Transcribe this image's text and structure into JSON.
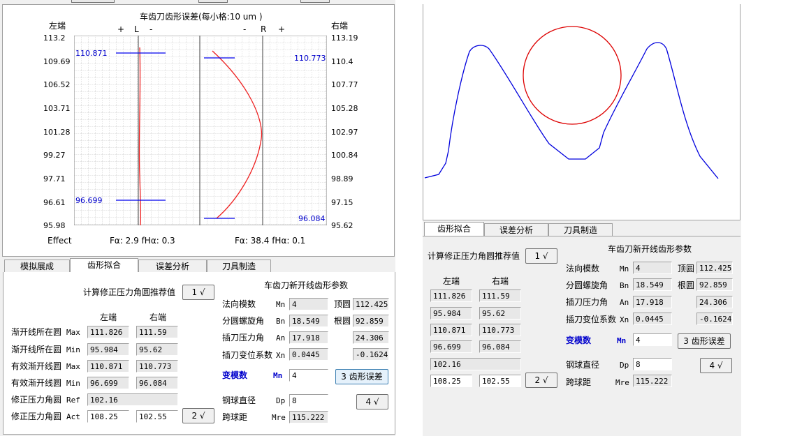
{
  "chart": {
    "title": "车齿刀齿形误差(每小格:10 um )",
    "left_label": "左端",
    "right_label": "右端",
    "L_marks": [
      "+",
      "L",
      "-"
    ],
    "R_marks": [
      "-",
      "R",
      "+"
    ],
    "left_ticks": [
      "113.2",
      "109.69",
      "106.52",
      "103.71",
      "101.28",
      "99.27",
      "97.71",
      "96.61",
      "95.98"
    ],
    "right_ticks": [
      "113.19",
      "110.4",
      "107.77",
      "105.28",
      "102.97",
      "100.84",
      "98.89",
      "97.15",
      "95.62"
    ],
    "L_top": "110.871",
    "L_bottom": "96.699",
    "R_top": "110.773",
    "R_bottom": "96.084",
    "effect_label": "Effect",
    "L_effect": "Fα: 2.9   fHα: 0.3",
    "R_effect": "Fα: 38.4   fHα: 0.1"
  },
  "tabs_left": [
    "模拟展成",
    "齿形拟合",
    "误差分析",
    "刀具制造"
  ],
  "tabs_right": [
    "齿形拟合",
    "误差分析",
    "刀具制造"
  ],
  "left_panel": {
    "recommend_label": "计算修正压力角圆推荐值",
    "btn1": "1 √",
    "col_left": "左端",
    "col_right": "右端",
    "rows": [
      {
        "label": "渐开线所在圆",
        "code": "Max",
        "l": "111.826",
        "r": "111.59"
      },
      {
        "label": "渐开线所在圆",
        "code": "Min",
        "l": "95.984",
        "r": "95.62"
      },
      {
        "label": "有效渐开线圆",
        "code": "Max",
        "l": "110.871",
        "r": "110.773"
      },
      {
        "label": "有效渐开线圆",
        "code": "Min",
        "l": "96.699",
        "r": "96.084"
      }
    ],
    "ref_label": "修正压力角圆",
    "ref_code": "Ref",
    "ref_value": "102.16",
    "act_label": "修正压力角圆",
    "act_code": "Act",
    "act_l": "108.25",
    "act_r": "102.55",
    "btn2": "2 √"
  },
  "params": {
    "title": "车齿刀新开线齿形参数",
    "mn_label": "法向模数",
    "mn_code": "Mn",
    "mn_value": "4",
    "top_label": "顶圆",
    "top_value": "112.425",
    "bn_label": "分圆螺旋角",
    "bn_code": "Bn",
    "bn_value": "18.549",
    "root_label": "根圆",
    "root_value": "92.859",
    "an_label": "插刀压力角",
    "an_code": "An",
    "an_value": "17.918",
    "extra1": "24.306",
    "xn_label": "插刀变位系数",
    "xn_code": "Xn",
    "xn_value": "0.0445",
    "extra2": "-0.1624",
    "var_label": "变模数",
    "var_code": "Mn",
    "var_value": "4",
    "btn3": "3 齿形误差",
    "btn4": "4 √",
    "dp_label": "钢球直径",
    "dp_code": "Dp",
    "dp_value": "8",
    "mre_label": "跨球距",
    "mre_code": "Mre",
    "mre_value": "115.222"
  },
  "right_panel": {
    "recommend_label": "计算修正压力角圆推荐值",
    "btn1": "1 √",
    "col_left": "左端",
    "col_right": "右端",
    "rows": [
      {
        "l": "111.826",
        "r": "111.59"
      },
      {
        "l": "95.984",
        "r": "95.62"
      },
      {
        "l": "110.871",
        "r": "110.773"
      },
      {
        "l": "96.699",
        "r": "96.084"
      }
    ],
    "ref_value": "102.16",
    "act_l": "108.25",
    "act_r": "102.55",
    "btn2": "2 √"
  },
  "colors": {
    "profile": "#0000dd",
    "circle": "#dd0000",
    "curve": "#ee2222",
    "marker": "#0000ee"
  }
}
